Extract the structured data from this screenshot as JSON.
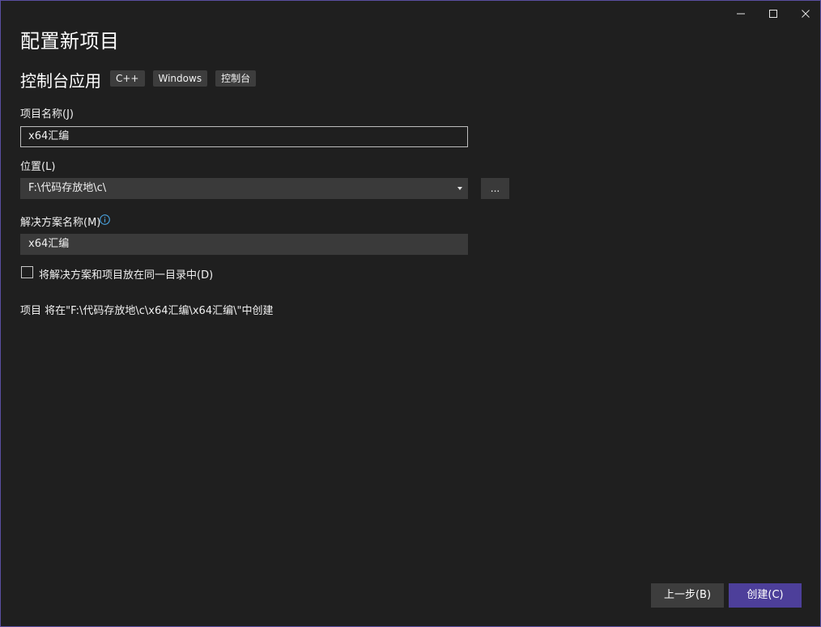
{
  "window": {
    "title": "配置新项目",
    "subtitle": "控制台应用",
    "tags": [
      "C++",
      "Windows",
      "控制台"
    ]
  },
  "form": {
    "project_name_label": "项目名称(J)",
    "project_name_value": "x64汇编",
    "location_label": "位置(L)",
    "location_value": "F:\\代码存放地\\c\\",
    "browse_label": "...",
    "solution_name_label": "解决方案名称(M)",
    "solution_name_value": "x64汇编",
    "same_dir_checkbox_label": "将解决方案和项目放在同一目录中(D)",
    "same_dir_checked": false,
    "path_info": "项目 将在\"F:\\代码存放地\\c\\x64汇编\\x64汇编\\\"中创建"
  },
  "buttons": {
    "back_label": "上一步(B)",
    "create_label": "创建(C)"
  },
  "colors": {
    "accent": "#4d3f9a",
    "background": "#1f1f1f",
    "info_icon": "#4aa3df"
  },
  "icons": {
    "minimize": "minimize-icon",
    "maximize": "maximize-icon",
    "close": "close-icon",
    "info": "info-icon",
    "dropdown": "chevron-down-icon"
  }
}
